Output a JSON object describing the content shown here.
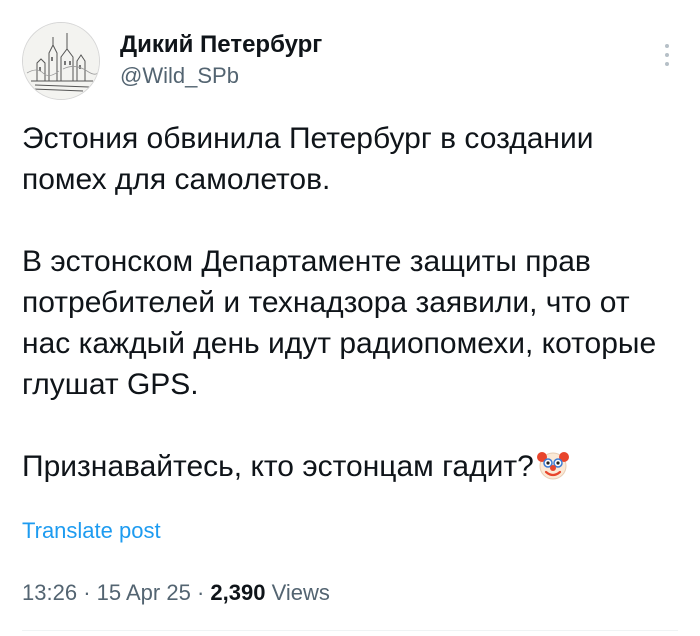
{
  "author": {
    "display_name": "Дикий Петербург",
    "handle": "@Wild_SPb",
    "avatar_icon": "city-skyline-sketch-icon"
  },
  "post": {
    "paragraphs": [
      "Эстония обвинила Петербург в создании помех для самолетов.",
      "В эстонском Департаменте защиты прав потребителей и технадзора заявили, что от нас каждый день идут радиопомехи, которые глушат GPS.",
      "Признавайтесь, кто эстонцам гадит?"
    ],
    "trailing_emoji": "clown-face-icon"
  },
  "translate_label": "Translate post",
  "meta": {
    "time": "13:26",
    "separator": "·",
    "date": "15 Apr 25",
    "views_count": "2,390",
    "views_label": "Views"
  },
  "colors": {
    "text": "#0f1419",
    "secondary": "#536471",
    "link": "#1d9bf0"
  }
}
